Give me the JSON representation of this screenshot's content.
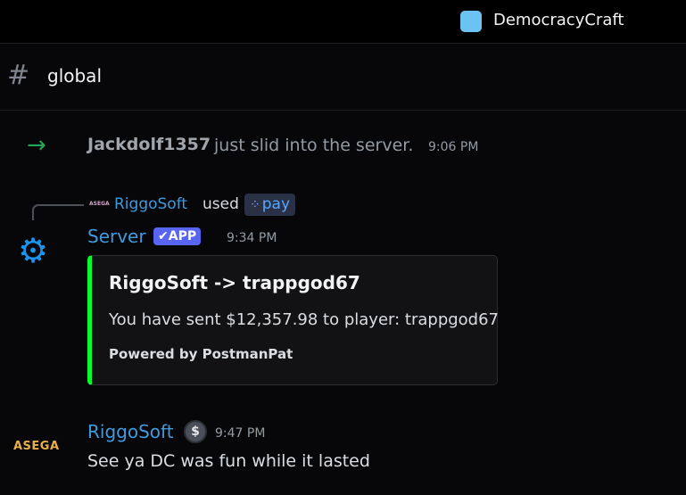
{
  "server": {
    "name": "DemocracyCraft",
    "icon": "server-icon"
  },
  "channel": {
    "hash": "#",
    "name": "global"
  },
  "join_message": {
    "arrow": "→",
    "user": "Jackdolf1357",
    "text": "just slid into the server.",
    "time": "9:06 PM"
  },
  "command_reply": {
    "avatar_text": "ASEGA",
    "user": "RiggoSoft",
    "used_text": "used",
    "command_icon": "⁘",
    "command": "pay"
  },
  "bot_message": {
    "icon": "gear-icon",
    "author": "Server",
    "badge": "✔APP",
    "time": "9:34 PM",
    "embed": {
      "accent_color": "#00ff2a",
      "title": "RiggoSoft -> trappgod67",
      "description": "You have sent $12,357.98 to player: trappgod67",
      "footer": "Powered by PostmanPat"
    }
  },
  "user_message": {
    "avatar_text": "ASEGA",
    "author": "RiggoSoft",
    "badge_icon": "$",
    "time": "9:47 PM",
    "text": "See ya DC was fun while it lasted"
  }
}
